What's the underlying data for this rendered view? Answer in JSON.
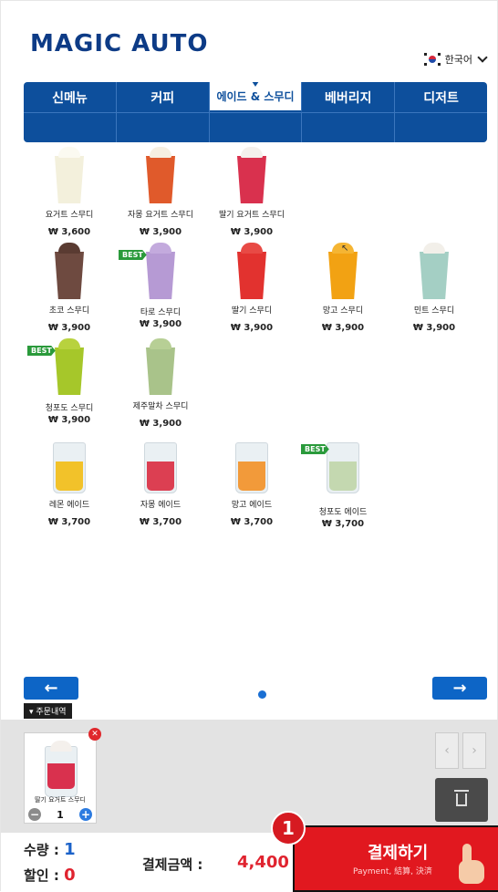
{
  "brand": {
    "logo": "MAGIC AUTO"
  },
  "language": {
    "label": "한국어"
  },
  "tabs": [
    {
      "label": "신메뉴"
    },
    {
      "label": "커피"
    },
    {
      "label": "에이드 & 스무디"
    },
    {
      "label": "베버리지"
    },
    {
      "label": "디저트"
    }
  ],
  "products": [
    {
      "name": "요거트 스무디",
      "price": "₩ 3,600",
      "color": "#f3f0dc",
      "top": "#fbfaf1",
      "best": false
    },
    {
      "name": "자몽 요거트 스무디",
      "price": "₩ 3,900",
      "color": "#e05a2b",
      "top": "#f6efe1",
      "best": false
    },
    {
      "name": "딸기 요거트 스무디",
      "price": "₩ 3,900",
      "color": "#d9314e",
      "top": "#f4f0ec",
      "best": false
    },
    {
      "name": "초코 스무디",
      "price": "₩ 3,900",
      "color": "#6e4a40",
      "top": "#5a3b32",
      "best": false
    },
    {
      "name": "타로 스무디",
      "price": "₩ 3,900",
      "color": "#b69ad4",
      "top": "#c3aadd",
      "best": true
    },
    {
      "name": "딸기 스무디",
      "price": "₩ 3,900",
      "color": "#e2322f",
      "top": "#e84a45",
      "best": false
    },
    {
      "name": "망고 스무디",
      "price": "₩ 3,900",
      "color": "#f2a213",
      "top": "#f5b533",
      "best": false
    },
    {
      "name": "민트 스무디",
      "price": "₩ 3,900",
      "color": "#a4cfc4",
      "top": "#f2efe9",
      "best": false
    },
    {
      "name": "청포도 스무디",
      "price": "₩ 3,900",
      "color": "#a6c72a",
      "top": "#b8d23e",
      "best": true
    },
    {
      "name": "제주말차 스무디",
      "price": "₩ 3,900",
      "color": "#a9c38a",
      "top": "#b7cf95",
      "best": false
    },
    {
      "name": "레몬 에이드",
      "price": "₩ 3,700",
      "color": "#f2c22a",
      "top": "#eef2f0",
      "best": false
    },
    {
      "name": "자몽 에이드",
      "price": "₩ 3,700",
      "color": "#dc3f52",
      "top": "#f0e5ea",
      "best": false
    },
    {
      "name": "망고 에이드",
      "price": "₩ 3,700",
      "color": "#f29a3a",
      "top": "#f1ede7",
      "best": false
    },
    {
      "name": "청포도 에이드",
      "price": "₩ 3,700",
      "color": "#c4d8b0",
      "top": "#e9efe8",
      "best": true
    }
  ],
  "best_label": "BEST",
  "nav": {
    "prev": "←",
    "next": "→"
  },
  "order": {
    "tag": "주문내역",
    "item_name": "딸기 요거트 스무디",
    "quantity": "1",
    "remove": "✕",
    "minus": "−",
    "plus": "+"
  },
  "pager": {
    "prev": "‹",
    "next": "›"
  },
  "footer": {
    "qty_label": "수량 :",
    "qty_value": "1",
    "discount_label": "할인 :",
    "discount_value": "0",
    "total_label": "결제금액 :",
    "total_value": "4,400",
    "pay_label": "결제하기",
    "pay_sub": "Payment, 結算, 決済",
    "step_badge": "1"
  },
  "colors": {
    "primary": "#0d4f9c",
    "accent_red": "#e1181f",
    "accent_blue": "#0d65c6"
  }
}
